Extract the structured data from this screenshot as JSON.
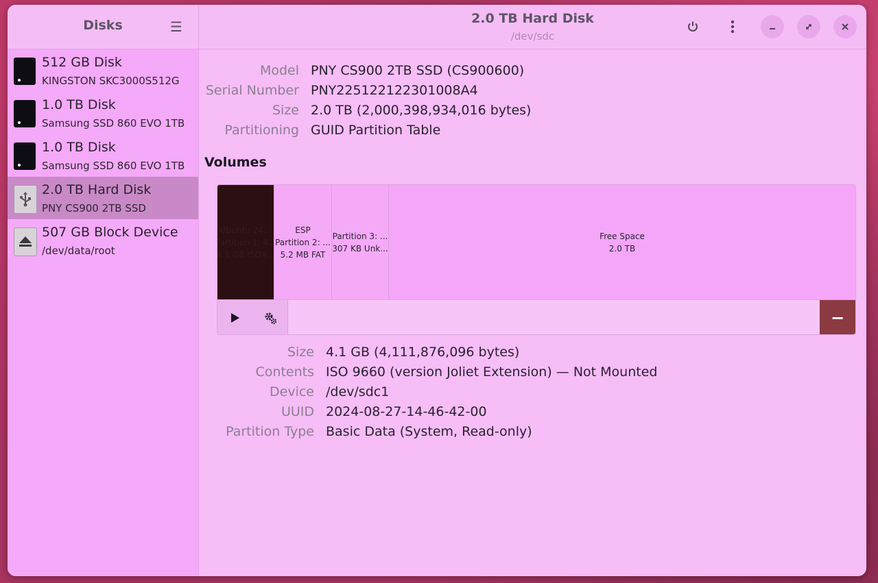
{
  "sidebar": {
    "title": "Disks",
    "menu_icon": "hamburger-menu-icon",
    "items": [
      {
        "name": "512 GB Disk",
        "sub": "KINGSTON SKC3000S512G",
        "icon": "drive-icon"
      },
      {
        "name": "1.0 TB Disk",
        "sub": "Samsung SSD 860 EVO 1TB",
        "icon": "drive-icon"
      },
      {
        "name": "1.0 TB Disk",
        "sub": "Samsung SSD 860 EVO 1TB",
        "icon": "drive-icon"
      },
      {
        "name": "2.0 TB Hard Disk",
        "sub": "PNY CS900 2TB SSD",
        "icon": "usb-icon",
        "selected": true
      },
      {
        "name": "507 GB Block Device",
        "sub": "/dev/data/root",
        "icon": "eject-icon"
      }
    ]
  },
  "header": {
    "title": "2.0 TB Hard Disk",
    "subtitle": "/dev/sdc",
    "buttons": [
      "power-icon",
      "kebab-menu-icon",
      "minimize-icon",
      "maximize-icon",
      "close-icon"
    ]
  },
  "disk_props": [
    {
      "label": "Model",
      "value": "PNY CS900 2TB SSD (CS900600)"
    },
    {
      "label": "Serial Number",
      "value": "PNY225122122301008A4"
    },
    {
      "label": "Size",
      "value": "2.0 TB (2,000,398,934,016 bytes)"
    },
    {
      "label": "Partitioning",
      "value": "GUID Partition Table"
    }
  ],
  "volumes": {
    "title": "Volumes",
    "partitions": [
      {
        "line1": "Ubuntu 24...",
        "line2": "Partition 1: 4...",
        "line3": "4.1 GB ISO9...",
        "selected": true
      },
      {
        "line1": "ESP",
        "line2": "Partition 2: ...",
        "line3": "5.2 MB FAT"
      },
      {
        "line1": "Partition 3: ...",
        "line2": "307 KB Unk...",
        "line3": ""
      },
      {
        "line1": "Free Space",
        "line2": "2.0 TB",
        "line3": ""
      }
    ]
  },
  "volume_props": [
    {
      "label": "Size",
      "value": "4.1 GB (4,111,876,096 bytes)"
    },
    {
      "label": "Contents",
      "value": "ISO 9660 (version Joliet Extension) — Not Mounted"
    },
    {
      "label": "Device",
      "value": "/dev/sdc1"
    },
    {
      "label": "UUID",
      "value": "2024-08-27-14-46-42-00"
    },
    {
      "label": "Partition Type",
      "value": "Basic Data (System, Read-only)"
    }
  ],
  "colors": {
    "selected_partition": "#2c0f12",
    "delete_button": "#8b3a42",
    "selected_sidebar": "#c989c7"
  }
}
